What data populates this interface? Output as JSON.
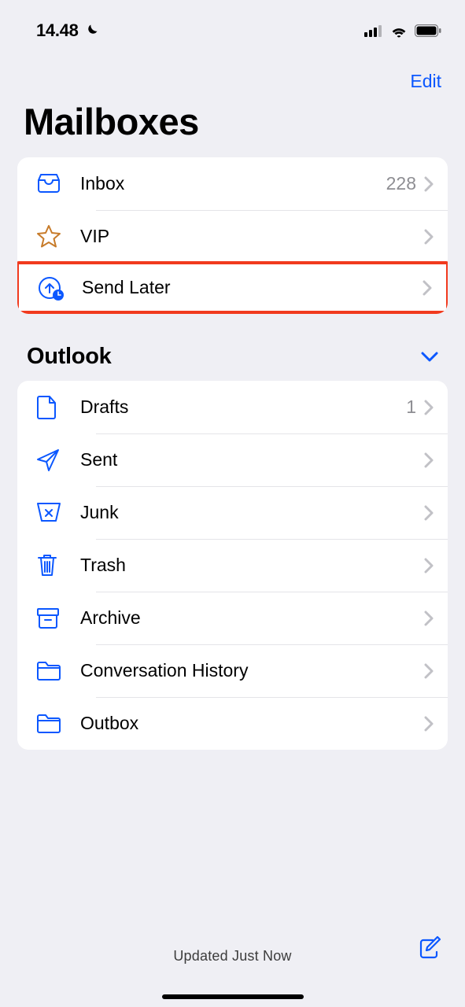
{
  "status": {
    "time": "14.48"
  },
  "nav": {
    "edit": "Edit"
  },
  "title": "Mailboxes",
  "mailboxes": [
    {
      "label": "Inbox",
      "count": "228"
    },
    {
      "label": "VIP",
      "count": ""
    },
    {
      "label": "Send Later",
      "count": ""
    }
  ],
  "section": {
    "label": "Outlook"
  },
  "account_folders": [
    {
      "label": "Drafts",
      "count": "1"
    },
    {
      "label": "Sent",
      "count": ""
    },
    {
      "label": "Junk",
      "count": ""
    },
    {
      "label": "Trash",
      "count": ""
    },
    {
      "label": "Archive",
      "count": ""
    },
    {
      "label": "Conversation History",
      "count": ""
    },
    {
      "label": "Outbox",
      "count": ""
    }
  ],
  "toolbar": {
    "status": "Updated Just Now"
  }
}
